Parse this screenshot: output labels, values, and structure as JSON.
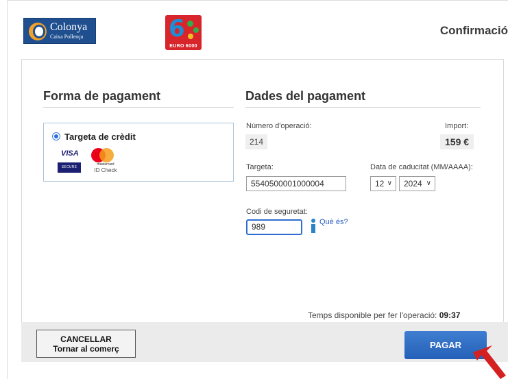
{
  "header": {
    "bank_name": "Colonya",
    "bank_subtitle": "Caixa Pollença",
    "network_logo_text": "EURO 6000",
    "title": "Confirmació"
  },
  "payment_method": {
    "section_title": "Forma de pagament",
    "option_label": "Targeta de crèdit",
    "option_selected": true,
    "visa_text": "VISA",
    "visa_badge": "SECURE",
    "mastercard_text": "mastercard",
    "mastercard_check": "ID Check"
  },
  "payment_details": {
    "section_title": "Dades del pagament",
    "operation_label": "Número d'operació:",
    "operation_value": "214",
    "amount_label": "Import:",
    "amount_value": "159 €",
    "card_label": "Targeta:",
    "card_value": "5540500001000004",
    "expiry_label": "Data de caducitat (MM/AAAA):",
    "expiry_month": "12",
    "expiry_year": "2024",
    "cvv_label": "Codi de seguretat:",
    "cvv_value": "989",
    "cvv_help_link": "Què és?"
  },
  "timer": {
    "label": "Temps disponible per fer l'operació:",
    "value": "09:37"
  },
  "actions": {
    "cancel_line1": "CANCELLAR",
    "cancel_line2": "Tornar al comerç",
    "pay_label": "PAGAR"
  },
  "colors": {
    "accent_blue": "#2f6ecf",
    "pay_button": "#2a66bd",
    "arrow": "#d42020"
  }
}
